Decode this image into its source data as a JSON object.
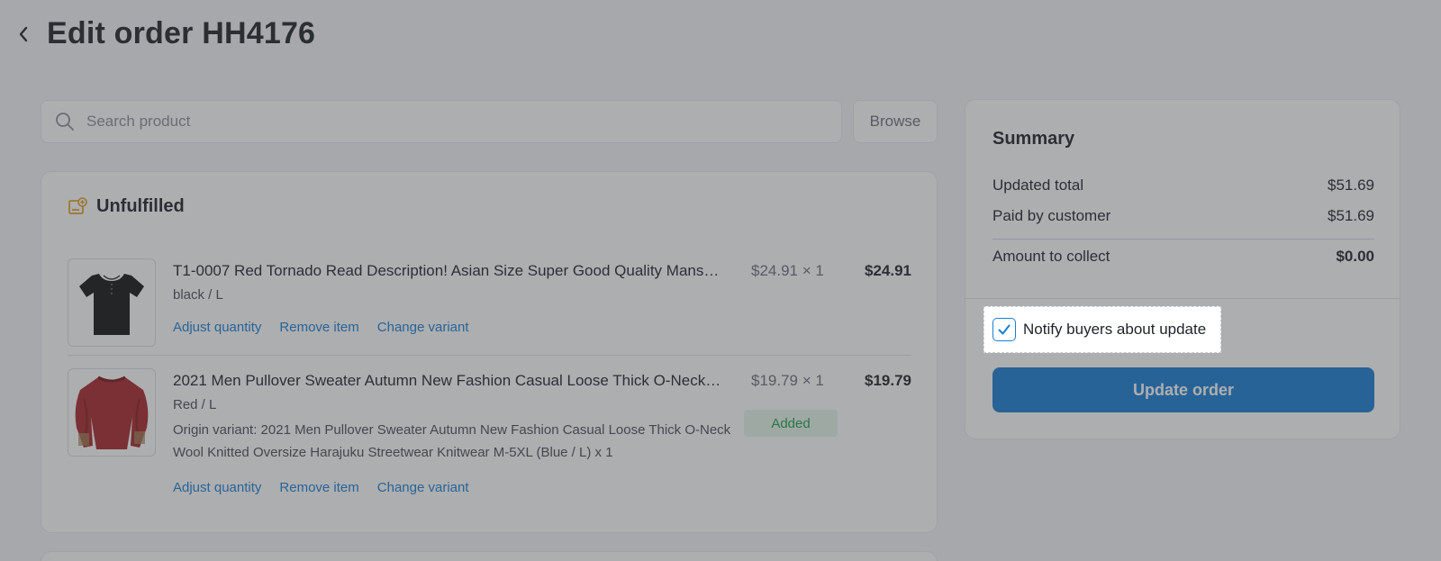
{
  "header": {
    "title": "Edit order HH4176"
  },
  "search": {
    "placeholder": "Search product",
    "browse_label": "Browse"
  },
  "unfulfilled": {
    "title": "Unfulfilled",
    "items": [
      {
        "title": "T1-0007 Red Tornado Read Description! Asian Size Super Good Quality Mans…",
        "variant": "black / L",
        "price": "$24.91 × 1",
        "total": "$24.91",
        "actions": [
          "Adjust quantity",
          "Remove item",
          "Change variant"
        ]
      },
      {
        "title": "2021 Men Pullover Sweater Autumn New Fashion Casual Loose Thick O-Neck…",
        "variant": "Red / L",
        "origin": "Origin variant: 2021 Men Pullover Sweater Autumn New Fashion Casual Loose Thick O-Neck Wool Knitted Oversize Harajuku Streetwear Knitwear M-5XL (Blue / L) x 1",
        "price": "$19.79 × 1",
        "total": "$19.79",
        "badge": "Added",
        "actions": [
          "Adjust quantity",
          "Remove item",
          "Change variant"
        ]
      }
    ]
  },
  "summary": {
    "title": "Summary",
    "rows": [
      {
        "label": "Updated total",
        "value": "$51.69"
      },
      {
        "label": "Paid by customer",
        "value": "$51.69"
      },
      {
        "label": "Amount to collect",
        "value": "$0.00"
      }
    ],
    "notify_label": "Notify buyers about update",
    "notify_checked": true,
    "update_label": "Update order"
  },
  "colors": {
    "accent": "#1a7fd4",
    "added_green": "#1e9e4a",
    "unfulfilled_icon": "#e0a326"
  },
  "icons": {
    "back": "chevron-left-icon",
    "search": "search-icon",
    "unfulfilled": "unfulfilled-box-icon",
    "check": "check-icon"
  }
}
